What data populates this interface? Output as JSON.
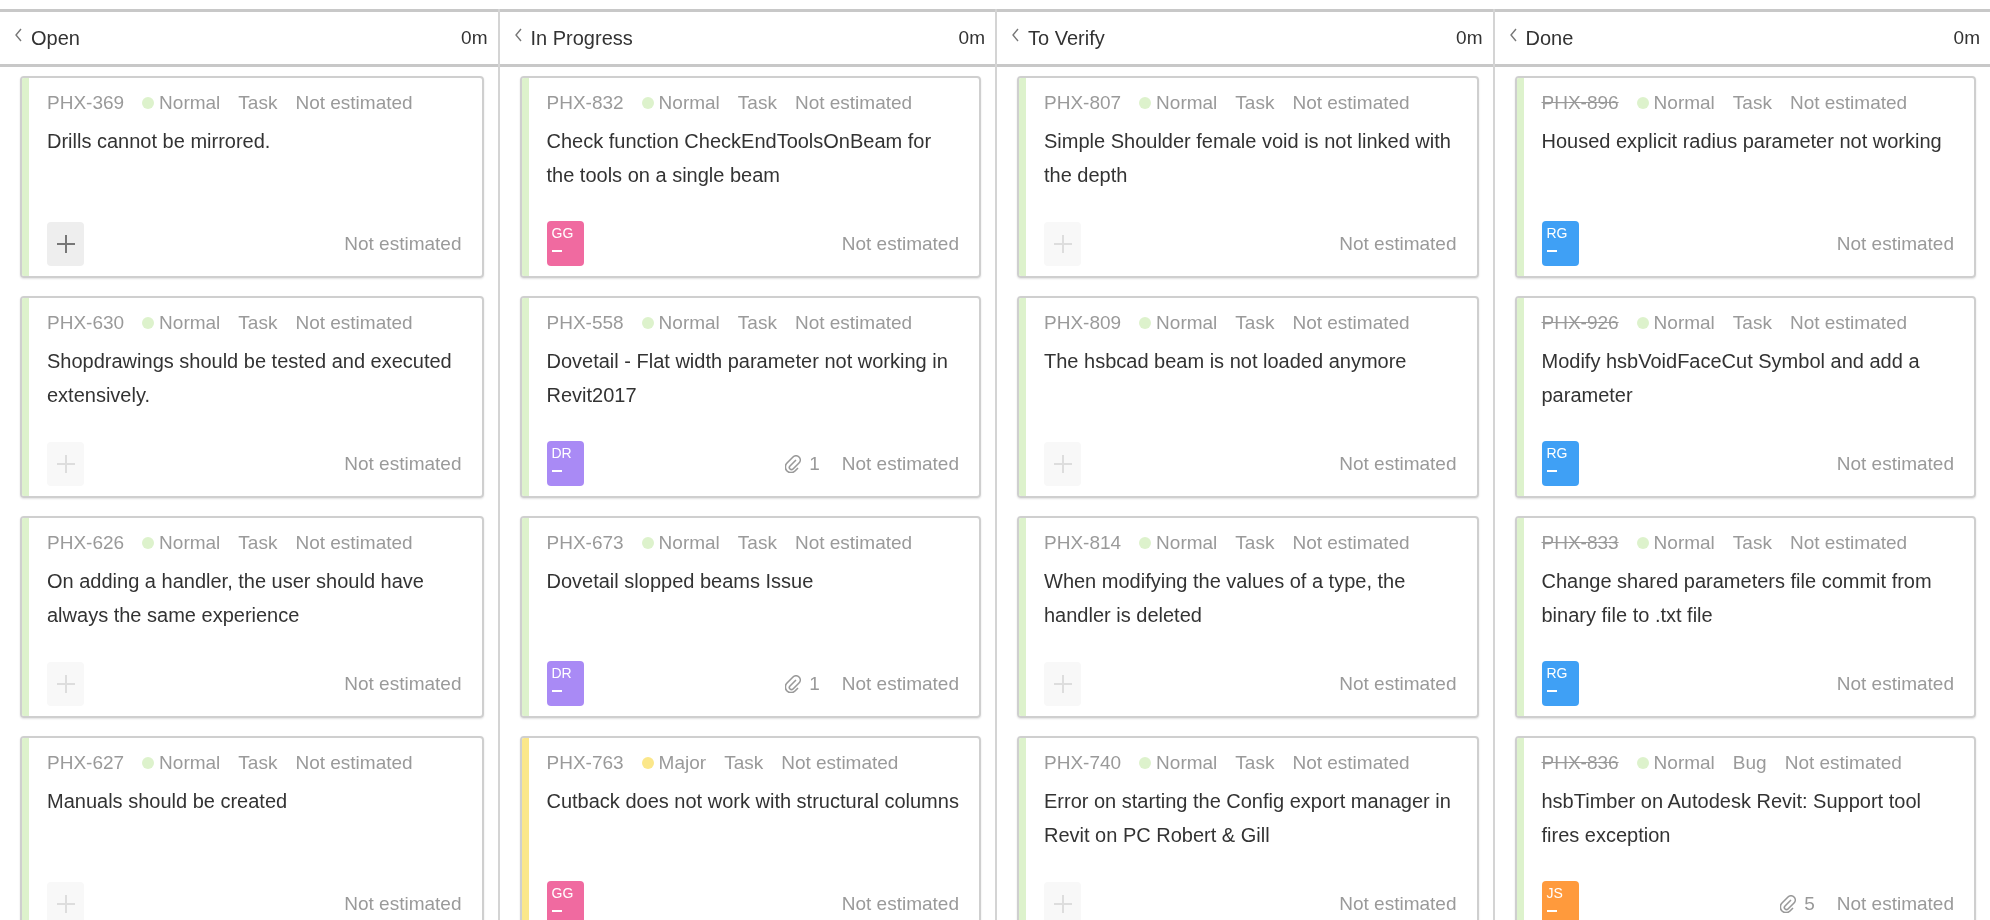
{
  "columns": [
    {
      "title": "Open",
      "time": "0m",
      "cards": [
        {
          "id": "PHX-369",
          "resolved": false,
          "priority": {
            "label": "Normal",
            "color": "#ddf2cc"
          },
          "type": "Task",
          "estimate": "Not estimated",
          "title": "Drills cannot be mirrored.",
          "footer": {
            "kind": "add",
            "highlighted": true
          },
          "footer_estimate": "Not estimated"
        },
        {
          "id": "PHX-630",
          "resolved": false,
          "priority": {
            "label": "Normal",
            "color": "#ddf2cc"
          },
          "type": "Task",
          "estimate": "Not estimated",
          "title": "Shopdrawings should be tested and executed extensively.",
          "footer": {
            "kind": "add",
            "highlighted": false
          },
          "footer_estimate": "Not estimated"
        },
        {
          "id": "PHX-626",
          "resolved": false,
          "priority": {
            "label": "Normal",
            "color": "#ddf2cc"
          },
          "type": "Task",
          "estimate": "Not estimated",
          "title": "On adding a handler, the user should have always the same experience",
          "footer": {
            "kind": "add",
            "highlighted": false
          },
          "footer_estimate": "Not estimated"
        },
        {
          "id": "PHX-627",
          "resolved": false,
          "priority": {
            "label": "Normal",
            "color": "#ddf2cc"
          },
          "type": "Task",
          "estimate": "Not estimated",
          "title": "Manuals should be created",
          "footer": {
            "kind": "add",
            "highlighted": false
          },
          "footer_estimate": "Not estimated"
        }
      ]
    },
    {
      "title": "In Progress",
      "time": "0m",
      "cards": [
        {
          "id": "PHX-832",
          "resolved": false,
          "priority": {
            "label": "Normal",
            "color": "#ddf2cc"
          },
          "type": "Task",
          "estimate": "Not estimated",
          "title": "Check function CheckEndToolsOnBeam for the tools on a single beam",
          "footer": {
            "kind": "avatar",
            "initials": "GG",
            "color": "#f06aa0"
          },
          "footer_estimate": "Not estimated"
        },
        {
          "id": "PHX-558",
          "resolved": false,
          "priority": {
            "label": "Normal",
            "color": "#ddf2cc"
          },
          "type": "Task",
          "estimate": "Not estimated",
          "title": "Dovetail - Flat width parameter not working in Revit2017",
          "footer": {
            "kind": "avatar",
            "initials": "DR",
            "color": "#a98af5"
          },
          "attachments": "1",
          "footer_estimate": "Not estimated"
        },
        {
          "id": "PHX-673",
          "resolved": false,
          "priority": {
            "label": "Normal",
            "color": "#ddf2cc"
          },
          "type": "Task",
          "estimate": "Not estimated",
          "title": "Dovetail slopped beams Issue",
          "footer": {
            "kind": "avatar",
            "initials": "DR",
            "color": "#a98af5"
          },
          "attachments": "1",
          "footer_estimate": "Not estimated"
        },
        {
          "id": "PHX-763",
          "resolved": false,
          "priority": {
            "label": "Major",
            "color": "#fbe78a"
          },
          "type": "Task",
          "estimate": "Not estimated",
          "title": "Cutback does not work with structural columns",
          "footer": {
            "kind": "avatar",
            "initials": "GG",
            "color": "#f06aa0"
          },
          "footer_estimate": "Not estimated"
        }
      ]
    },
    {
      "title": "To Verify",
      "time": "0m",
      "cards": [
        {
          "id": "PHX-807",
          "resolved": false,
          "priority": {
            "label": "Normal",
            "color": "#ddf2cc"
          },
          "type": "Task",
          "estimate": "Not estimated",
          "title": "Simple Shoulder female void is not linked with the depth",
          "footer": {
            "kind": "add",
            "highlighted": false
          },
          "footer_estimate": "Not estimated"
        },
        {
          "id": "PHX-809",
          "resolved": false,
          "priority": {
            "label": "Normal",
            "color": "#ddf2cc"
          },
          "type": "Task",
          "estimate": "Not estimated",
          "title": "The hsbcad beam is not loaded anymore",
          "footer": {
            "kind": "add",
            "highlighted": false
          },
          "footer_estimate": "Not estimated"
        },
        {
          "id": "PHX-814",
          "resolved": false,
          "priority": {
            "label": "Normal",
            "color": "#ddf2cc"
          },
          "type": "Task",
          "estimate": "Not estimated",
          "title": "When modifying the values of a type, the handler is deleted",
          "footer": {
            "kind": "add",
            "highlighted": false
          },
          "footer_estimate": "Not estimated"
        },
        {
          "id": "PHX-740",
          "resolved": false,
          "priority": {
            "label": "Normal",
            "color": "#ddf2cc"
          },
          "type": "Task",
          "estimate": "Not estimated",
          "title": "Error on starting the Config export manager in Revit on PC Robert & Gill",
          "footer": {
            "kind": "add",
            "highlighted": false
          },
          "footer_estimate": "Not estimated"
        }
      ]
    },
    {
      "title": "Done",
      "time": "0m",
      "cards": [
        {
          "id": "PHX-896",
          "resolved": true,
          "priority": {
            "label": "Normal",
            "color": "#ddf2cc"
          },
          "type": "Task",
          "estimate": "Not estimated",
          "title": "Housed explicit radius parameter not working",
          "footer": {
            "kind": "avatar",
            "initials": "RG",
            "color": "#3fa0f5"
          },
          "footer_estimate": "Not estimated"
        },
        {
          "id": "PHX-926",
          "resolved": true,
          "priority": {
            "label": "Normal",
            "color": "#ddf2cc"
          },
          "type": "Task",
          "estimate": "Not estimated",
          "title": "Modify hsbVoidFaceCut Symbol and add a parameter",
          "footer": {
            "kind": "avatar",
            "initials": "RG",
            "color": "#3fa0f5"
          },
          "footer_estimate": "Not estimated"
        },
        {
          "id": "PHX-833",
          "resolved": true,
          "priority": {
            "label": "Normal",
            "color": "#ddf2cc"
          },
          "type": "Task",
          "estimate": "Not estimated",
          "title": "Change shared parameters file commit from binary file to .txt file",
          "footer": {
            "kind": "avatar",
            "initials": "RG",
            "color": "#3fa0f5"
          },
          "footer_estimate": "Not estimated"
        },
        {
          "id": "PHX-836",
          "resolved": true,
          "priority": {
            "label": "Normal",
            "color": "#ddf2cc"
          },
          "type": "Bug",
          "estimate": "Not estimated",
          "title": "hsbTimber on Autodesk Revit: Support tool fires exception",
          "footer": {
            "kind": "avatar",
            "initials": "JS",
            "color": "#ff9a3c"
          },
          "attachments": "5",
          "footer_estimate": "Not estimated"
        }
      ]
    }
  ]
}
